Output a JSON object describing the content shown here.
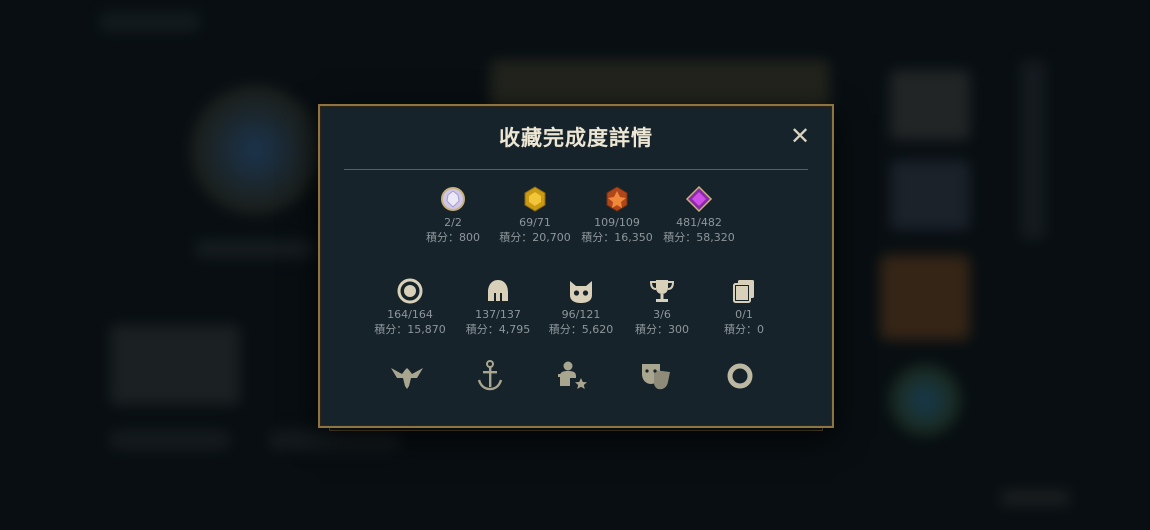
{
  "modal": {
    "title": "收藏完成度詳情",
    "close_label": "✕"
  },
  "rows": [
    {
      "items": [
        {
          "icon": "gem-white-icon",
          "count": "2/2",
          "score": "積分：800"
        },
        {
          "icon": "gem-gold-icon",
          "count": "69/71",
          "score": "積分：20,700"
        },
        {
          "icon": "gem-orange-icon",
          "count": "109/109",
          "score": "積分：16,350"
        },
        {
          "icon": "gem-purple-icon",
          "count": "481/482",
          "score": "積分：58,320"
        }
      ]
    },
    {
      "items": [
        {
          "icon": "ward-ring-icon",
          "count": "164/164",
          "score": "積分：15,870"
        },
        {
          "icon": "helmet-icon",
          "count": "137/137",
          "score": "積分：4,795"
        },
        {
          "icon": "cat-face-icon",
          "count": "96/121",
          "score": "積分：5,620"
        },
        {
          "icon": "trophy-icon",
          "count": "3/6",
          "score": "積分：300"
        },
        {
          "icon": "cards-icon",
          "count": "0/1",
          "score": "積分：0"
        }
      ]
    },
    {
      "items": [
        {
          "icon": "winged-emblem-icon"
        },
        {
          "icon": "anchor-icon"
        },
        {
          "icon": "person-star-icon"
        },
        {
          "icon": "masks-icon"
        },
        {
          "icon": "ring-icon"
        }
      ]
    }
  ],
  "colors": {
    "gold_border": "#8d7440",
    "modal_bg": "#16232b",
    "text_muted": "#8d969a"
  }
}
